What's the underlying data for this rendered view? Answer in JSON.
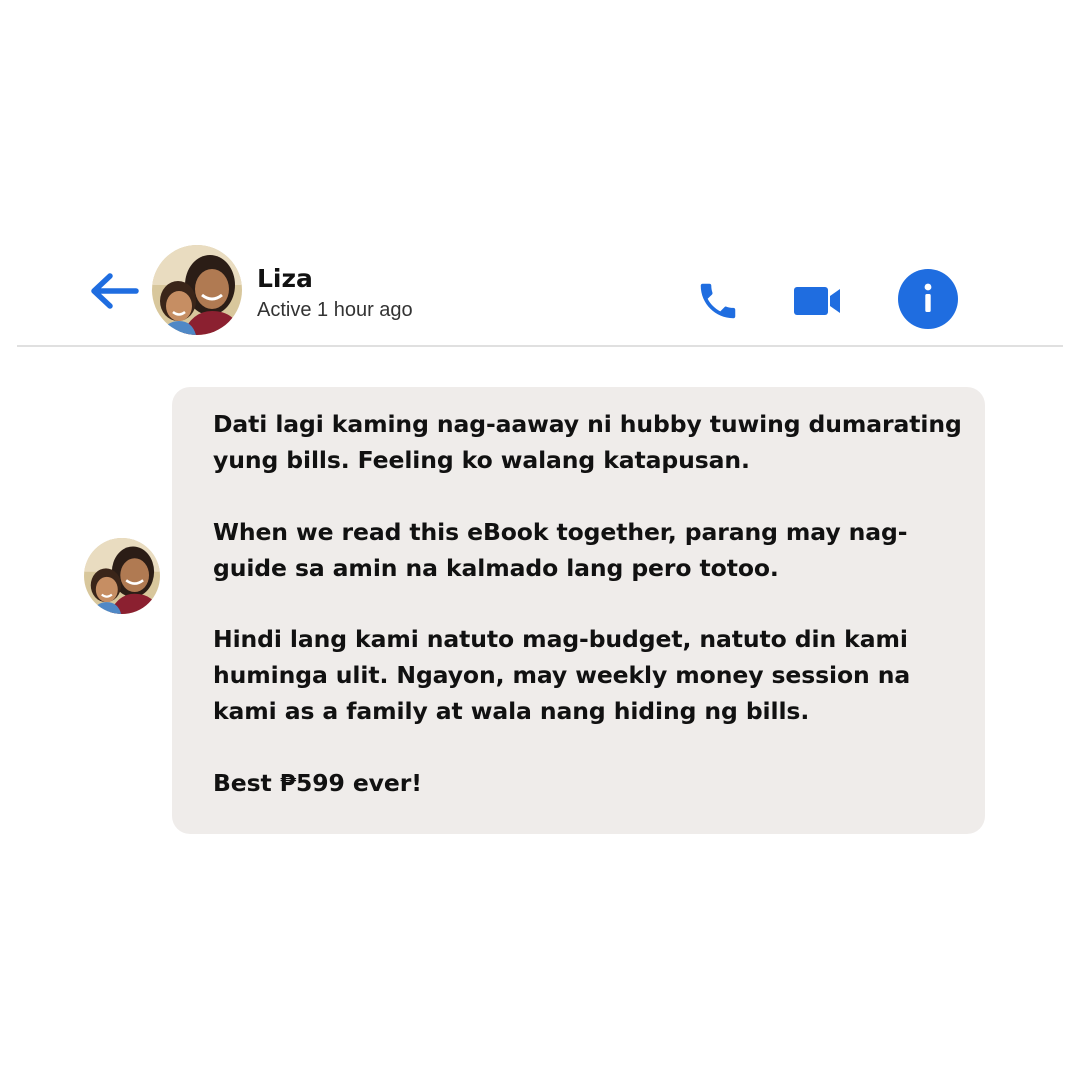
{
  "header": {
    "contact_name": "Liza",
    "status": "Active 1 hour ago"
  },
  "colors": {
    "accent": "#1f6de0",
    "bubble_background": "#efecea",
    "divider": "#e0e0e0"
  },
  "icons": {
    "back": "arrow-left-icon",
    "call": "phone-icon",
    "video": "video-camera-icon",
    "info": "info-icon"
  },
  "message": {
    "paragraphs": [
      "Dati lagi kaming nag-aaway ni hubby tuwing dumarating yung bills. Feeling ko walang katapusan.",
      "When we read this eBook together, parang may nag-guide sa amin na kalmado lang pero totoo.",
      "Hindi lang kami natuto mag-budget, natuto din kami huminga ulit. Ngayon, may weekly money session na kami as a family at wala nang hiding ng bills.",
      "Best ₱599 ever!"
    ]
  }
}
